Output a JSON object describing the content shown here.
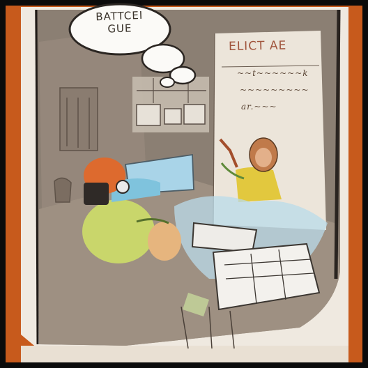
{
  "scene": {
    "speech_bubble": {
      "line1": "BATTCEI",
      "line2": "GUE"
    },
    "poster": {
      "title": "ELICT AE",
      "lines": [
        "~~t~~~~~~k",
        "~~~~~~~~~",
        "ar.~~~"
      ]
    }
  },
  "colors": {
    "outer_frame": "#0b0b0b",
    "orange_edge": "#c75a1c",
    "paper": "#f0ebe3",
    "wall": "#8a7e72",
    "floor": "#9d8f82",
    "character_body": "#c9d66b",
    "character_hair": "#d9662a",
    "screen_blue": "#a9d4e8"
  }
}
